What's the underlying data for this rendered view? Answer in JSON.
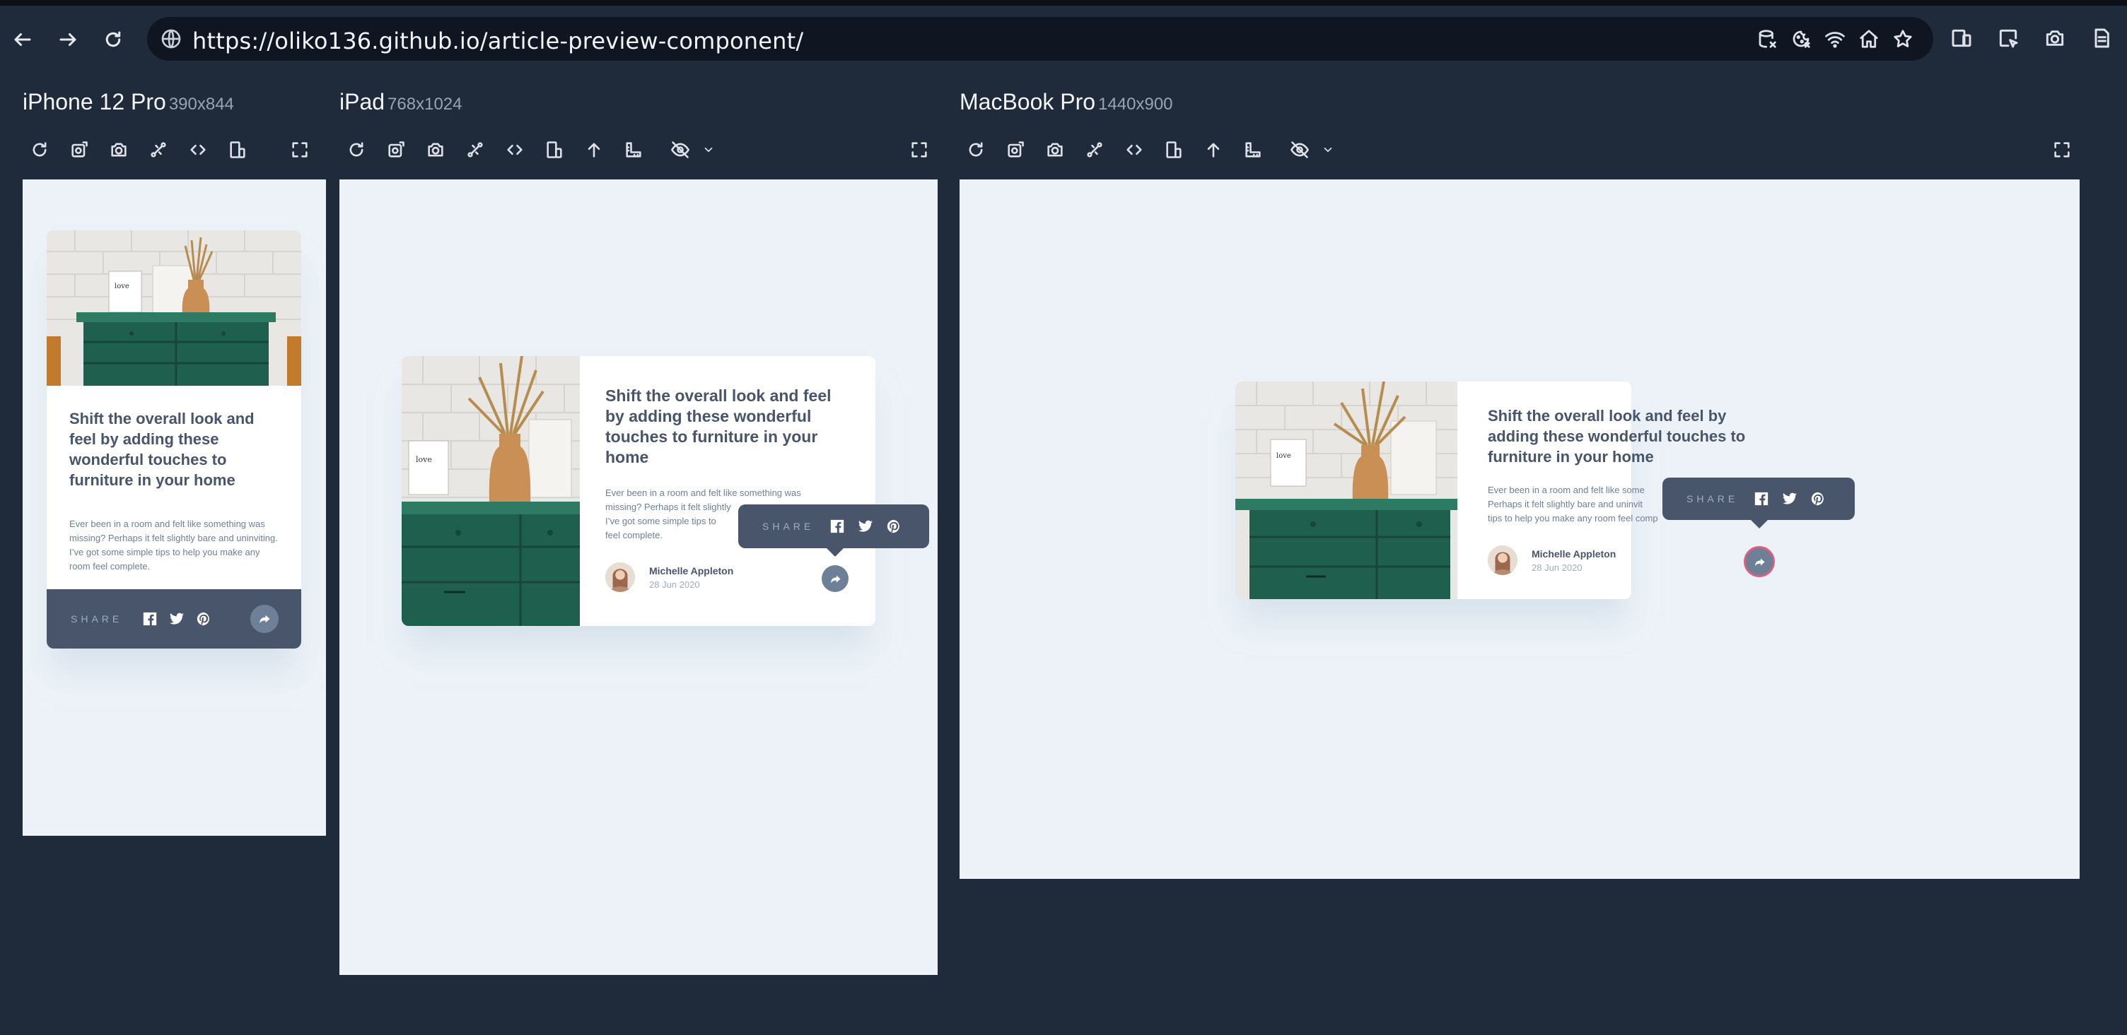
{
  "browser": {
    "url": "https://oliko136.github.io/article-preview-component/",
    "nav": [
      "back-icon",
      "forward-icon",
      "reload-icon"
    ],
    "url_icons": [
      "database-icon",
      "cookie-icon",
      "wifi-icon",
      "home-icon",
      "star-icon"
    ],
    "extension_icons": [
      "devices-icon",
      "cursor-window-icon",
      "camera-icon",
      "document-icon"
    ]
  },
  "devices": [
    {
      "name": "iPhone 12 Pro",
      "dims": "390x844"
    },
    {
      "name": "iPad",
      "dims": "768x1024"
    },
    {
      "name": "MacBook Pro",
      "dims": "1440x900"
    }
  ],
  "article": {
    "title": "Shift the overall look and feel by adding these wonderful touches to furniture in your home",
    "description": "Ever been in a room and felt like something was missing? Perhaps it felt slightly bare and uninviting. I’ve got some simple tips to help you make any room feel complete.",
    "ipad_description_visible": "Ever been in a room and felt like something was missing? Perhaps it felt slightly",
    "ipad_description_line3": "I’ve got some simple tips to",
    "ipad_description_line4": "feel complete.",
    "mac_description_line1": "Ever been in a room and felt like some",
    "mac_description_line2": "Perhaps it felt slightly bare and uninvit",
    "mac_description_line3": "tips to help you make any room feel comp",
    "author_name": "Michelle Appleton",
    "author_date": "28 Jun 2020",
    "share_label": "SHARE",
    "social_icons": [
      "facebook-icon",
      "twitter-icon",
      "pinterest-icon"
    ]
  },
  "colors": {
    "page_bg": "#1f2a3a",
    "viewport_bg": "#ecf2f8",
    "card_dark": "#48556a",
    "text_muted": "#6e8098",
    "accent_light": "#9daec2"
  }
}
